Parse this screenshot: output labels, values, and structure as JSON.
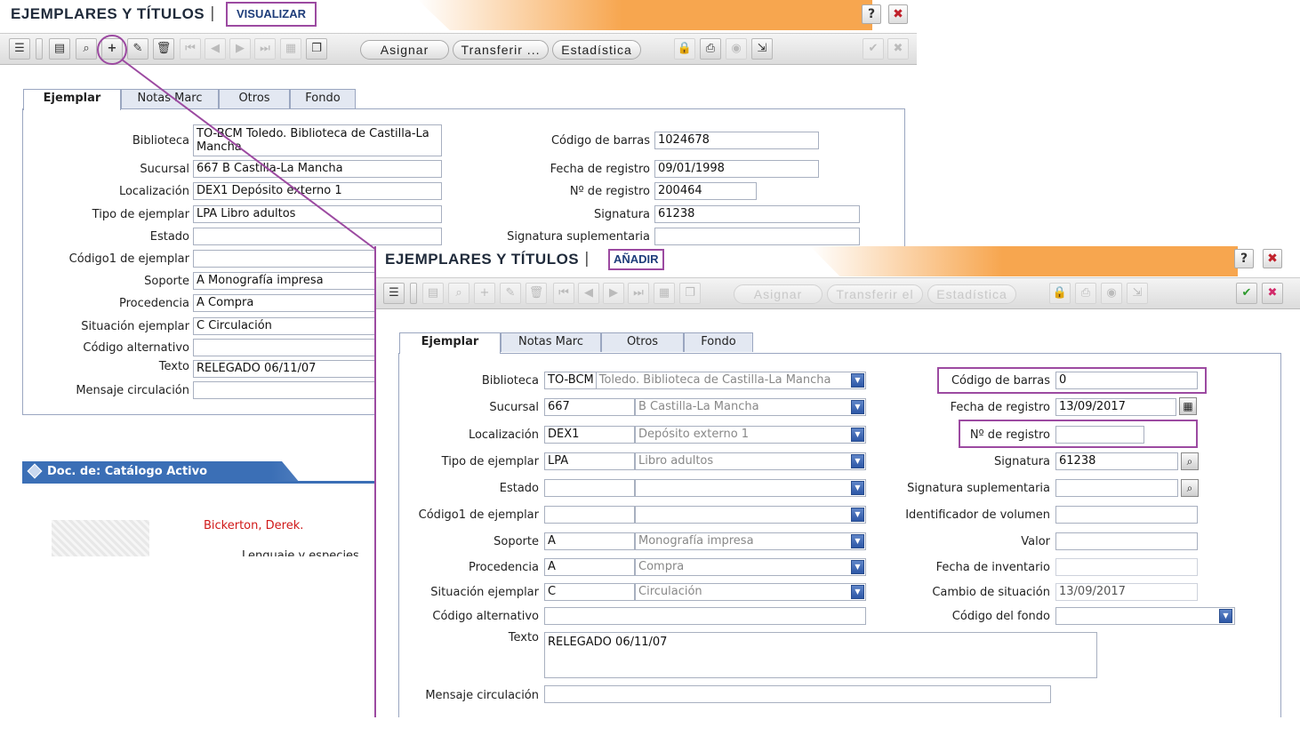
{
  "back": {
    "title": "EJEMPLARES Y TÍTULOS",
    "separator": "|",
    "mode": "VISUALIZAR",
    "help": "?",
    "close": "✖",
    "toolbar": {
      "assign": "Asignar",
      "transfer": "Transferir ...",
      "stats": "Estadística",
      "add": "+"
    },
    "tabs": [
      "Ejemplar",
      "Notas Marc",
      "Otros",
      "Fondo"
    ],
    "fields": {
      "biblioteca_label": "Biblioteca",
      "biblioteca_code": "TO-BCM",
      "biblioteca_value": "Toledo. Biblioteca de Castilla-La Mancha",
      "sucursal_label": "Sucursal",
      "sucursal_code": "667",
      "sucursal_value": "B Castilla-La Mancha",
      "localizacion_label": "Localización",
      "localizacion_code": "DEX1",
      "localizacion_value": "Depósito externo 1",
      "tipo_label": "Tipo de ejemplar",
      "tipo_code": "LPA",
      "tipo_value": "Libro adultos",
      "estado_label": "Estado",
      "codigo1_label": "Código1 de ejemplar",
      "soporte_label": "Soporte",
      "soporte_code": "A",
      "soporte_value": "Monografía impresa",
      "procedencia_label": "Procedencia",
      "procedencia_code": "A",
      "procedencia_value": "Compra",
      "situacion_label": "Situación ejemplar",
      "situacion_code": "C",
      "situacion_value": "Circulación",
      "alternativo_label": "Código alternativo",
      "texto_label": "Texto",
      "texto_value": "RELEGADO 06/11/07",
      "mensaje_label": "Mensaje circulación",
      "barras_label": "Código de barras",
      "barras_value": "1024678",
      "fecha_label": "Fecha de registro",
      "fecha_value": "09/01/1998",
      "nreg_label": "Nº de registro",
      "nreg_value": "200464",
      "signatura_label": "Signatura",
      "signatura_value": "61238",
      "sigsup_label": "Signatura suplementaria"
    },
    "doc_header": "Doc. de: Catálogo Activo",
    "author": "Bickerton, Derek.",
    "book_title": "Lenguaje y especies"
  },
  "front": {
    "title": "EJEMPLARES Y TÍTULOS",
    "separator": "|",
    "mode": "AÑADIR",
    "help": "?",
    "close": "✖",
    "toolbar": {
      "assign": "Asignar",
      "transfer": "Transferir el",
      "stats": "Estadística",
      "accept": "✔",
      "cancel": "✖"
    },
    "tabs": [
      "Ejemplar",
      "Notas Marc",
      "Otros",
      "Fondo"
    ],
    "fields": {
      "biblioteca_label": "Biblioteca",
      "biblioteca_code": "TO-BCM",
      "biblioteca_value": "Toledo. Biblioteca de Castilla-La Mancha",
      "sucursal_label": "Sucursal",
      "sucursal_code": "667",
      "sucursal_value": "B Castilla-La Mancha",
      "localizacion_label": "Localización",
      "localizacion_code": "DEX1",
      "localizacion_value": "Depósito externo 1",
      "tipo_label": "Tipo de ejemplar",
      "tipo_code": "LPA",
      "tipo_value": "Libro adultos",
      "estado_label": "Estado",
      "codigo1_label": "Código1 de ejemplar",
      "soporte_label": "Soporte",
      "soporte_code": "A",
      "soporte_value": "Monografía impresa",
      "procedencia_label": "Procedencia",
      "procedencia_code": "A",
      "procedencia_value": "Compra",
      "situacion_label": "Situación ejemplar",
      "situacion_code": "C",
      "situacion_value": "Circulación",
      "alternativo_label": "Código alternativo",
      "texto_label": "Texto",
      "texto_value": "RELEGADO 06/11/07",
      "mensaje_label": "Mensaje circulación",
      "barras_label": "Código de barras",
      "barras_value": "0",
      "fecha_label": "Fecha de registro",
      "fecha_value": "13/09/2017",
      "nreg_label": "Nº de registro",
      "nreg_value": "",
      "signatura_label": "Signatura",
      "signatura_value": "61238",
      "sigsup_label": "Signatura suplementaria",
      "volumen_label": "Identificador de volumen",
      "valor_label": "Valor",
      "inventario_label": "Fecha de inventario",
      "cambio_label": "Cambio de situación",
      "cambio_value": "13/09/2017",
      "fondo_label": "Código del fondo"
    }
  },
  "colors": {
    "highlight": "#9c4aa1",
    "title_stripe": "#f7a64f",
    "dropdown": "#2d57a6",
    "doc_header": "#3b6fb6",
    "author": "#d01818"
  }
}
